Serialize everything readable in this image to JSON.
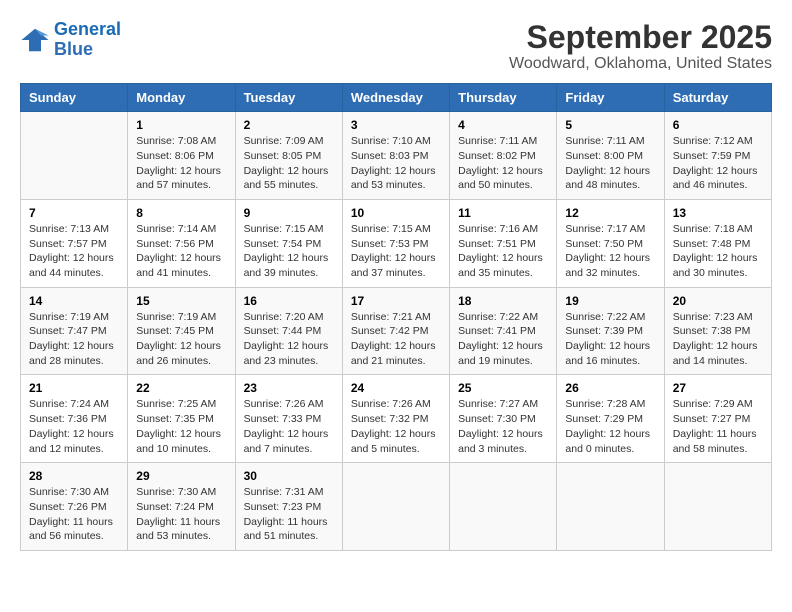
{
  "logo": {
    "line1": "General",
    "line2": "Blue"
  },
  "title": "September 2025",
  "subtitle": "Woodward, Oklahoma, United States",
  "days_of_week": [
    "Sunday",
    "Monday",
    "Tuesday",
    "Wednesday",
    "Thursday",
    "Friday",
    "Saturday"
  ],
  "weeks": [
    [
      {
        "num": "",
        "info": ""
      },
      {
        "num": "1",
        "info": "Sunrise: 7:08 AM\nSunset: 8:06 PM\nDaylight: 12 hours\nand 57 minutes."
      },
      {
        "num": "2",
        "info": "Sunrise: 7:09 AM\nSunset: 8:05 PM\nDaylight: 12 hours\nand 55 minutes."
      },
      {
        "num": "3",
        "info": "Sunrise: 7:10 AM\nSunset: 8:03 PM\nDaylight: 12 hours\nand 53 minutes."
      },
      {
        "num": "4",
        "info": "Sunrise: 7:11 AM\nSunset: 8:02 PM\nDaylight: 12 hours\nand 50 minutes."
      },
      {
        "num": "5",
        "info": "Sunrise: 7:11 AM\nSunset: 8:00 PM\nDaylight: 12 hours\nand 48 minutes."
      },
      {
        "num": "6",
        "info": "Sunrise: 7:12 AM\nSunset: 7:59 PM\nDaylight: 12 hours\nand 46 minutes."
      }
    ],
    [
      {
        "num": "7",
        "info": "Sunrise: 7:13 AM\nSunset: 7:57 PM\nDaylight: 12 hours\nand 44 minutes."
      },
      {
        "num": "8",
        "info": "Sunrise: 7:14 AM\nSunset: 7:56 PM\nDaylight: 12 hours\nand 41 minutes."
      },
      {
        "num": "9",
        "info": "Sunrise: 7:15 AM\nSunset: 7:54 PM\nDaylight: 12 hours\nand 39 minutes."
      },
      {
        "num": "10",
        "info": "Sunrise: 7:15 AM\nSunset: 7:53 PM\nDaylight: 12 hours\nand 37 minutes."
      },
      {
        "num": "11",
        "info": "Sunrise: 7:16 AM\nSunset: 7:51 PM\nDaylight: 12 hours\nand 35 minutes."
      },
      {
        "num": "12",
        "info": "Sunrise: 7:17 AM\nSunset: 7:50 PM\nDaylight: 12 hours\nand 32 minutes."
      },
      {
        "num": "13",
        "info": "Sunrise: 7:18 AM\nSunset: 7:48 PM\nDaylight: 12 hours\nand 30 minutes."
      }
    ],
    [
      {
        "num": "14",
        "info": "Sunrise: 7:19 AM\nSunset: 7:47 PM\nDaylight: 12 hours\nand 28 minutes."
      },
      {
        "num": "15",
        "info": "Sunrise: 7:19 AM\nSunset: 7:45 PM\nDaylight: 12 hours\nand 26 minutes."
      },
      {
        "num": "16",
        "info": "Sunrise: 7:20 AM\nSunset: 7:44 PM\nDaylight: 12 hours\nand 23 minutes."
      },
      {
        "num": "17",
        "info": "Sunrise: 7:21 AM\nSunset: 7:42 PM\nDaylight: 12 hours\nand 21 minutes."
      },
      {
        "num": "18",
        "info": "Sunrise: 7:22 AM\nSunset: 7:41 PM\nDaylight: 12 hours\nand 19 minutes."
      },
      {
        "num": "19",
        "info": "Sunrise: 7:22 AM\nSunset: 7:39 PM\nDaylight: 12 hours\nand 16 minutes."
      },
      {
        "num": "20",
        "info": "Sunrise: 7:23 AM\nSunset: 7:38 PM\nDaylight: 12 hours\nand 14 minutes."
      }
    ],
    [
      {
        "num": "21",
        "info": "Sunrise: 7:24 AM\nSunset: 7:36 PM\nDaylight: 12 hours\nand 12 minutes."
      },
      {
        "num": "22",
        "info": "Sunrise: 7:25 AM\nSunset: 7:35 PM\nDaylight: 12 hours\nand 10 minutes."
      },
      {
        "num": "23",
        "info": "Sunrise: 7:26 AM\nSunset: 7:33 PM\nDaylight: 12 hours\nand 7 minutes."
      },
      {
        "num": "24",
        "info": "Sunrise: 7:26 AM\nSunset: 7:32 PM\nDaylight: 12 hours\nand 5 minutes."
      },
      {
        "num": "25",
        "info": "Sunrise: 7:27 AM\nSunset: 7:30 PM\nDaylight: 12 hours\nand 3 minutes."
      },
      {
        "num": "26",
        "info": "Sunrise: 7:28 AM\nSunset: 7:29 PM\nDaylight: 12 hours\nand 0 minutes."
      },
      {
        "num": "27",
        "info": "Sunrise: 7:29 AM\nSunset: 7:27 PM\nDaylight: 11 hours\nand 58 minutes."
      }
    ],
    [
      {
        "num": "28",
        "info": "Sunrise: 7:30 AM\nSunset: 7:26 PM\nDaylight: 11 hours\nand 56 minutes."
      },
      {
        "num": "29",
        "info": "Sunrise: 7:30 AM\nSunset: 7:24 PM\nDaylight: 11 hours\nand 53 minutes."
      },
      {
        "num": "30",
        "info": "Sunrise: 7:31 AM\nSunset: 7:23 PM\nDaylight: 11 hours\nand 51 minutes."
      },
      {
        "num": "",
        "info": ""
      },
      {
        "num": "",
        "info": ""
      },
      {
        "num": "",
        "info": ""
      },
      {
        "num": "",
        "info": ""
      }
    ]
  ]
}
